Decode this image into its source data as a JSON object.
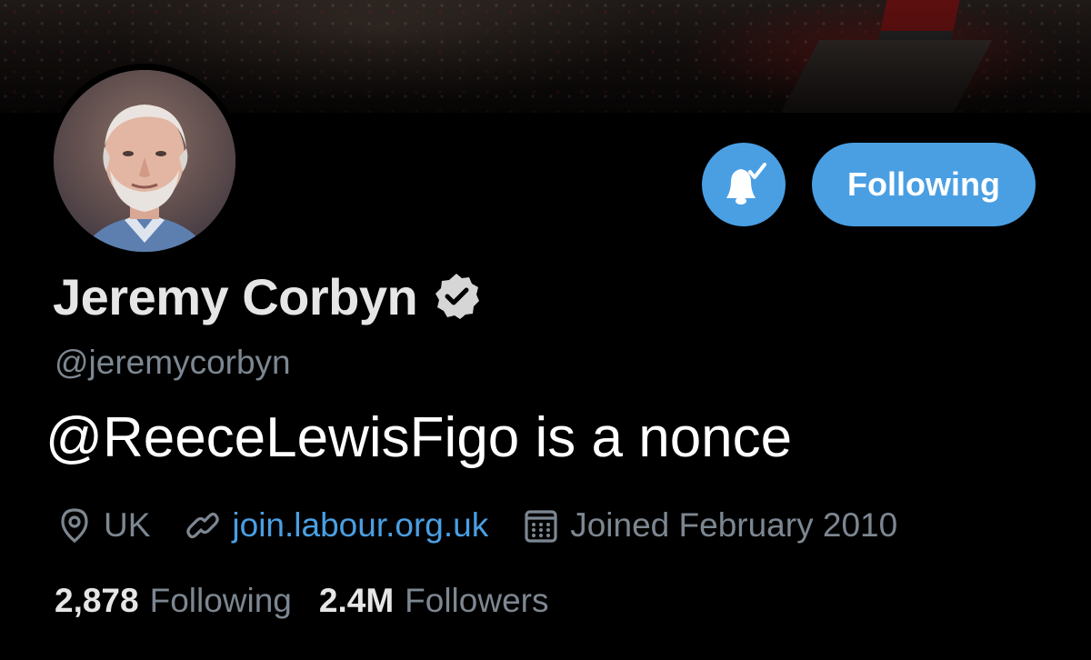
{
  "profile": {
    "display_name": "Jeremy Corbyn",
    "handle": "@jeremycorbyn",
    "bio": "@ReeceLewisFigo is a nonce",
    "verified": true
  },
  "actions": {
    "follow_label": "Following",
    "notification_icon": "bell-check-icon"
  },
  "meta": {
    "location": "UK",
    "location_icon": "location-pin-icon",
    "website": "join.labour.org.uk",
    "website_icon": "link-icon",
    "joined": "Joined February 2010",
    "joined_icon": "calendar-icon"
  },
  "stats": {
    "following_count": "2,878",
    "following_label": "Following",
    "followers_count": "2.4M",
    "followers_label": "Followers"
  },
  "colors": {
    "accent": "#4a9fe3",
    "background": "#000000",
    "primary_text": "#e6e6e6",
    "secondary_text": "#7d8791"
  }
}
